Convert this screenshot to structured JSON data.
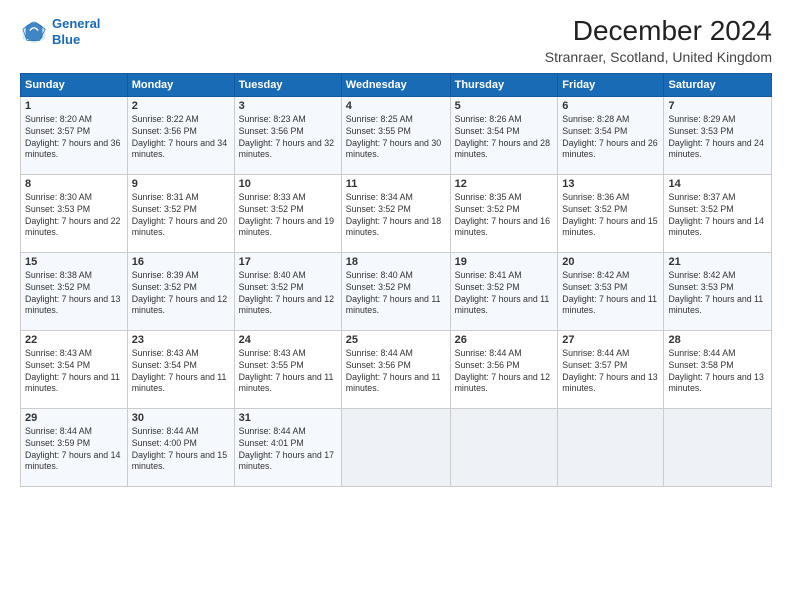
{
  "logo": {
    "line1": "General",
    "line2": "Blue"
  },
  "title": "December 2024",
  "subtitle": "Stranraer, Scotland, United Kingdom",
  "days_of_week": [
    "Sunday",
    "Monday",
    "Tuesday",
    "Wednesday",
    "Thursday",
    "Friday",
    "Saturday"
  ],
  "weeks": [
    [
      {
        "day": "1",
        "sunrise": "8:20 AM",
        "sunset": "3:57 PM",
        "daylight": "7 hours and 36 minutes."
      },
      {
        "day": "2",
        "sunrise": "8:22 AM",
        "sunset": "3:56 PM",
        "daylight": "7 hours and 34 minutes."
      },
      {
        "day": "3",
        "sunrise": "8:23 AM",
        "sunset": "3:56 PM",
        "daylight": "7 hours and 32 minutes."
      },
      {
        "day": "4",
        "sunrise": "8:25 AM",
        "sunset": "3:55 PM",
        "daylight": "7 hours and 30 minutes."
      },
      {
        "day": "5",
        "sunrise": "8:26 AM",
        "sunset": "3:54 PM",
        "daylight": "7 hours and 28 minutes."
      },
      {
        "day": "6",
        "sunrise": "8:28 AM",
        "sunset": "3:54 PM",
        "daylight": "7 hours and 26 minutes."
      },
      {
        "day": "7",
        "sunrise": "8:29 AM",
        "sunset": "3:53 PM",
        "daylight": "7 hours and 24 minutes."
      }
    ],
    [
      {
        "day": "8",
        "sunrise": "8:30 AM",
        "sunset": "3:53 PM",
        "daylight": "7 hours and 22 minutes."
      },
      {
        "day": "9",
        "sunrise": "8:31 AM",
        "sunset": "3:52 PM",
        "daylight": "7 hours and 20 minutes."
      },
      {
        "day": "10",
        "sunrise": "8:33 AM",
        "sunset": "3:52 PM",
        "daylight": "7 hours and 19 minutes."
      },
      {
        "day": "11",
        "sunrise": "8:34 AM",
        "sunset": "3:52 PM",
        "daylight": "7 hours and 18 minutes."
      },
      {
        "day": "12",
        "sunrise": "8:35 AM",
        "sunset": "3:52 PM",
        "daylight": "7 hours and 16 minutes."
      },
      {
        "day": "13",
        "sunrise": "8:36 AM",
        "sunset": "3:52 PM",
        "daylight": "7 hours and 15 minutes."
      },
      {
        "day": "14",
        "sunrise": "8:37 AM",
        "sunset": "3:52 PM",
        "daylight": "7 hours and 14 minutes."
      }
    ],
    [
      {
        "day": "15",
        "sunrise": "8:38 AM",
        "sunset": "3:52 PM",
        "daylight": "7 hours and 13 minutes."
      },
      {
        "day": "16",
        "sunrise": "8:39 AM",
        "sunset": "3:52 PM",
        "daylight": "7 hours and 12 minutes."
      },
      {
        "day": "17",
        "sunrise": "8:40 AM",
        "sunset": "3:52 PM",
        "daylight": "7 hours and 12 minutes."
      },
      {
        "day": "18",
        "sunrise": "8:40 AM",
        "sunset": "3:52 PM",
        "daylight": "7 hours and 11 minutes."
      },
      {
        "day": "19",
        "sunrise": "8:41 AM",
        "sunset": "3:52 PM",
        "daylight": "7 hours and 11 minutes."
      },
      {
        "day": "20",
        "sunrise": "8:42 AM",
        "sunset": "3:53 PM",
        "daylight": "7 hours and 11 minutes."
      },
      {
        "day": "21",
        "sunrise": "8:42 AM",
        "sunset": "3:53 PM",
        "daylight": "7 hours and 11 minutes."
      }
    ],
    [
      {
        "day": "22",
        "sunrise": "8:43 AM",
        "sunset": "3:54 PM",
        "daylight": "7 hours and 11 minutes."
      },
      {
        "day": "23",
        "sunrise": "8:43 AM",
        "sunset": "3:54 PM",
        "daylight": "7 hours and 11 minutes."
      },
      {
        "day": "24",
        "sunrise": "8:43 AM",
        "sunset": "3:55 PM",
        "daylight": "7 hours and 11 minutes."
      },
      {
        "day": "25",
        "sunrise": "8:44 AM",
        "sunset": "3:56 PM",
        "daylight": "7 hours and 11 minutes."
      },
      {
        "day": "26",
        "sunrise": "8:44 AM",
        "sunset": "3:56 PM",
        "daylight": "7 hours and 12 minutes."
      },
      {
        "day": "27",
        "sunrise": "8:44 AM",
        "sunset": "3:57 PM",
        "daylight": "7 hours and 13 minutes."
      },
      {
        "day": "28",
        "sunrise": "8:44 AM",
        "sunset": "3:58 PM",
        "daylight": "7 hours and 13 minutes."
      }
    ],
    [
      {
        "day": "29",
        "sunrise": "8:44 AM",
        "sunset": "3:59 PM",
        "daylight": "7 hours and 14 minutes."
      },
      {
        "day": "30",
        "sunrise": "8:44 AM",
        "sunset": "4:00 PM",
        "daylight": "7 hours and 15 minutes."
      },
      {
        "day": "31",
        "sunrise": "8:44 AM",
        "sunset": "4:01 PM",
        "daylight": "7 hours and 17 minutes."
      },
      null,
      null,
      null,
      null
    ]
  ]
}
